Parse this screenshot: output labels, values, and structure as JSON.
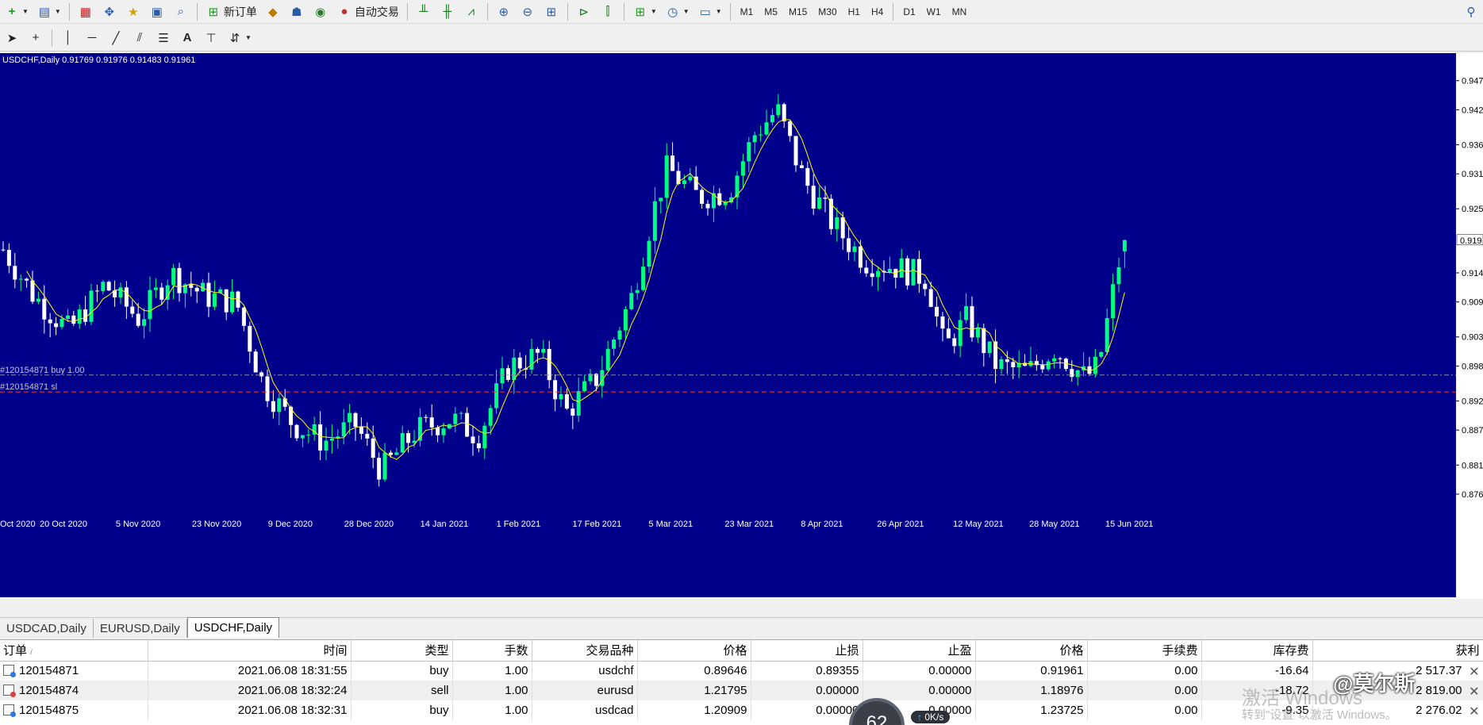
{
  "toolbar_top": {
    "new_order_label": "新订单",
    "auto_trade_label": "自动交易",
    "timeframes": [
      "M1",
      "M5",
      "M15",
      "M30",
      "H1",
      "H4",
      "D1",
      "W1",
      "MN"
    ]
  },
  "chart": {
    "header": "USDCHF,Daily  0.91769 0.91976 0.91483 0.91961",
    "background": "#00008b",
    "bull_color": "#00ff7f",
    "bear_color": "#ffffff",
    "ma_color": "#ffff00",
    "price_scale": [
      "0.947",
      "0.942",
      "0.936",
      "0.931",
      "0.925",
      "0.914",
      "0.909",
      "0.903",
      "0.898",
      "0.892",
      "0.887",
      "0.881",
      "0.876"
    ],
    "current_price_tag": "0.919",
    "date_axis": [
      "Oct 2020",
      "20 Oct 2020",
      "5 Nov 2020",
      "23 Nov 2020",
      "9 Dec 2020",
      "28 Dec 2020",
      "14 Jan 2021",
      "1 Feb 2021",
      "17 Feb 2021",
      "5 Mar 2021",
      "23 Mar 2021",
      "8 Apr 2021",
      "26 Apr 2021",
      "12 May 2021",
      "28 May 2021",
      "15 Jun 2021"
    ],
    "order_line_label": "#120154871 buy 1.00",
    "sl_line_label": "#120154871 sl",
    "chart_data": {
      "type": "candlestick",
      "symbol": "USDCHF",
      "timeframe": "Daily",
      "last_ohlc": {
        "open": 0.91769,
        "high": 0.91976,
        "low": 0.91483,
        "close": 0.91961
      },
      "ylim": [
        0.873,
        0.949
      ],
      "x_start": "2020-10-05",
      "x_end": "2021-06-18",
      "close_path": [
        [
          "2020-10-05",
          0.918
        ],
        [
          "2020-10-12",
          0.91
        ],
        [
          "2020-10-20",
          0.904
        ],
        [
          "2020-10-28",
          0.912
        ],
        [
          "2020-11-05",
          0.906
        ],
        [
          "2020-11-12",
          0.914
        ],
        [
          "2020-11-20",
          0.91
        ],
        [
          "2020-11-27",
          0.909
        ],
        [
          "2020-12-03",
          0.895
        ],
        [
          "2020-12-10",
          0.888
        ],
        [
          "2020-12-17",
          0.885
        ],
        [
          "2020-12-24",
          0.888
        ],
        [
          "2020-12-30",
          0.88
        ],
        [
          "2021-01-07",
          0.887
        ],
        [
          "2021-01-15",
          0.889
        ],
        [
          "2021-01-21",
          0.886
        ],
        [
          "2021-01-28",
          0.898
        ],
        [
          "2021-02-04",
          0.9
        ],
        [
          "2021-02-10",
          0.89
        ],
        [
          "2021-02-17",
          0.896
        ],
        [
          "2021-02-25",
          0.91
        ],
        [
          "2021-03-02",
          0.925
        ],
        [
          "2021-03-05",
          0.932
        ],
        [
          "2021-03-12",
          0.927
        ],
        [
          "2021-03-19",
          0.928
        ],
        [
          "2021-03-25",
          0.938
        ],
        [
          "2021-03-30",
          0.942
        ],
        [
          "2021-04-05",
          0.93
        ],
        [
          "2021-04-12",
          0.922
        ],
        [
          "2021-04-19",
          0.916
        ],
        [
          "2021-04-26",
          0.915
        ],
        [
          "2021-05-03",
          0.913
        ],
        [
          "2021-05-07",
          0.901
        ],
        [
          "2021-05-12",
          0.906
        ],
        [
          "2021-05-19",
          0.898
        ],
        [
          "2021-05-26",
          0.897
        ],
        [
          "2021-06-01",
          0.901
        ],
        [
          "2021-06-08",
          0.896
        ],
        [
          "2021-06-11",
          0.898
        ],
        [
          "2021-06-16",
          0.917
        ],
        [
          "2021-06-18",
          0.9196
        ]
      ],
      "order_price": 0.89646,
      "stop_loss": 0.89355
    }
  },
  "tabs": [
    "USDCAD,Daily",
    "EURUSD,Daily",
    "USDCHF,Daily"
  ],
  "active_tab": 2,
  "terminal": {
    "columns": [
      "订单",
      "时间",
      "类型",
      "手数",
      "交易品种",
      "价格",
      "止损",
      "止盈",
      "价格",
      "手续费",
      "库存费",
      "获利"
    ],
    "rows": [
      {
        "order": "120154871",
        "time": "2021.06.08 18:31:55",
        "type": "buy",
        "lots": "1.00",
        "symbol": "usdchf",
        "open_price": "0.89646",
        "sl": "0.89355",
        "tp": "0.00000",
        "price": "0.91961",
        "commission": "0.00",
        "swap": "-16.64",
        "profit": "2 517.37"
      },
      {
        "order": "120154874",
        "time": "2021.06.08 18:32:24",
        "type": "sell",
        "lots": "1.00",
        "symbol": "eurusd",
        "open_price": "1.21795",
        "sl": "0.00000",
        "tp": "0.00000",
        "price": "1.18976",
        "commission": "0.00",
        "swap": "-18.72",
        "profit": "2 819.00"
      },
      {
        "order": "120154875",
        "time": "2021.06.08 18:32:31",
        "type": "buy",
        "lots": "1.00",
        "symbol": "usdcad",
        "open_price": "1.20909",
        "sl": "0.00000",
        "tp": "0.00000",
        "price": "1.23725",
        "commission": "0.00",
        "swap": "-9.35",
        "profit": "2 276.02"
      }
    ]
  },
  "overlay": {
    "watermark_line1": "激活 Windows",
    "watermark_line2": "转到\"设置\"以激活 Windows。",
    "brand": "@莫尔斯",
    "gauge_value": "62",
    "net_speed": "0K/s"
  }
}
